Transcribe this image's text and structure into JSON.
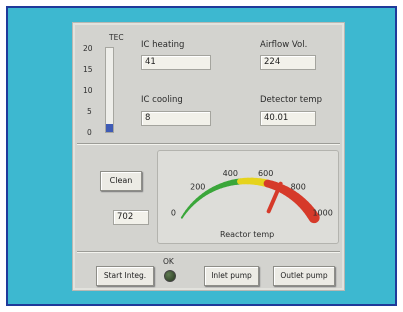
{
  "tec": {
    "label": "TEC",
    "scale_ticks": [
      "20",
      "15",
      "10",
      "5",
      "0"
    ],
    "level_fraction": 0.1
  },
  "fields": {
    "ic_heating": {
      "label": "IC heating",
      "value": "41"
    },
    "airflow_vol": {
      "label": "Airflow Vol.",
      "value": "224"
    },
    "ic_cooling": {
      "label": "IC cooling",
      "value": "8"
    },
    "detector_temp": {
      "label": "Detector temp",
      "value": "40.01"
    }
  },
  "clean_button": {
    "label": "Clean"
  },
  "reactor_readout": {
    "value": "702"
  },
  "gauge": {
    "label": "Reactor temp",
    "tick_labels": [
      "0",
      "200",
      "400",
      "600",
      "800",
      "1000"
    ],
    "min": 0,
    "max": 1000,
    "needle_value": 702
  },
  "bottom": {
    "start_button": "Start Integ.",
    "ok_label": "OK",
    "inlet_button": "Inlet pump",
    "outlet_button": "Outlet pump"
  },
  "colors": {
    "panel_background": "#d3d3cf",
    "frame_background": "#3db8d0",
    "frame_border": "#1f3a9a",
    "gauge_low": "#3aa63a",
    "gauge_mid": "#e6d31c",
    "gauge_high": "#d63a2a"
  }
}
